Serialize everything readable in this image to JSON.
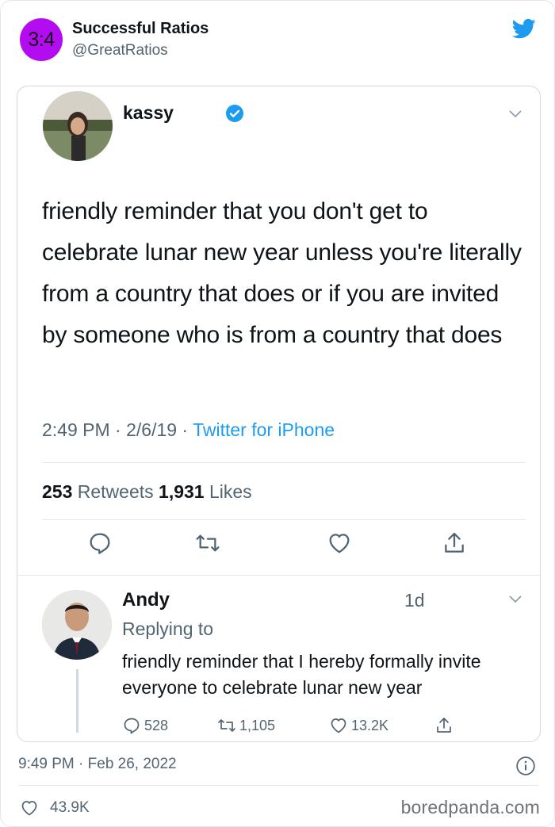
{
  "outer": {
    "avatar_text": "3:4",
    "name": "Successful Ratios",
    "handle": "@GreatRatios",
    "timestamp": "9:49 PM · Feb 26, 2022",
    "likes": "43.9K"
  },
  "quoted": {
    "name": "kassy",
    "text": "friendly reminder that you don't get to celebrate lunar new year unless you're literally from a country that does or if you are invited by someone who is from a country that does",
    "time": "2:49 PM · 2/6/19 · ",
    "client": "Twitter for iPhone",
    "retweets_count": "253",
    "retweets_label": "Retweets",
    "likes_count": "1,931",
    "likes_label": "Likes"
  },
  "reply": {
    "name": "Andy",
    "time": "1d",
    "replying_to": "Replying to",
    "text": "friendly reminder that I hereby formally invite everyone to celebrate lunar new year",
    "replies": "528",
    "retweets": "1,105",
    "likes": "13.2K"
  },
  "watermark": "boredpanda.com",
  "colors": {
    "accent": "#1d9bf0",
    "ratio_avatar": "#b40cf0",
    "secondary_text": "#536471"
  },
  "icons": [
    "twitter-bird-icon",
    "verified-badge-icon",
    "chevron-down-icon",
    "reply-icon",
    "retweet-icon",
    "heart-icon",
    "share-icon",
    "info-icon"
  ]
}
